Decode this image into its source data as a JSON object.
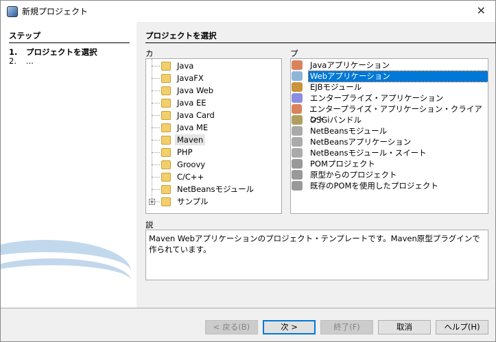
{
  "window": {
    "title": "新規プロジェクト",
    "close": "✕"
  },
  "steps": {
    "heading": "ステップ",
    "items": [
      {
        "num": "1.",
        "label": "プロジェクトを選択"
      },
      {
        "num": "2.",
        "label": "..."
      }
    ]
  },
  "main": {
    "heading": "プロジェクトを選択",
    "category_label": "カテゴリ(C):",
    "project_label": "プロジェクト(P):",
    "description_label": "説明(D):",
    "categories": [
      "Java",
      "JavaFX",
      "Java Web",
      "Java EE",
      "Java Card",
      "Java ME",
      "Maven",
      "PHP",
      "Groovy",
      "C/C++",
      "NetBeansモジュール",
      "サンプル"
    ],
    "selected_category": "Maven",
    "projects": [
      "Javaアプリケーション",
      "Webアプリケーション",
      "EJBモジュール",
      "エンタープライズ・アプリケーション",
      "エンタープライズ・アプリケーション・クライアント",
      "OSGiバンドル",
      "NetBeansモジュール",
      "NetBeansアプリケーション",
      "NetBeansモジュール・スイート",
      "POMプロジェクト",
      "原型からのプロジェクト",
      "既存のPOMを使用したプロジェクト"
    ],
    "selected_project": "Webアプリケーション",
    "description": "Maven Webアプリケーションのプロジェクト・テンプレートです。Maven原型プラグインで作られています。"
  },
  "buttons": {
    "back": "< 戻る(B)",
    "next": "次 >",
    "finish": "終了(F)",
    "cancel": "取消",
    "help": "ヘルプ(H)"
  },
  "colors": {
    "selection": "#0078d7"
  }
}
